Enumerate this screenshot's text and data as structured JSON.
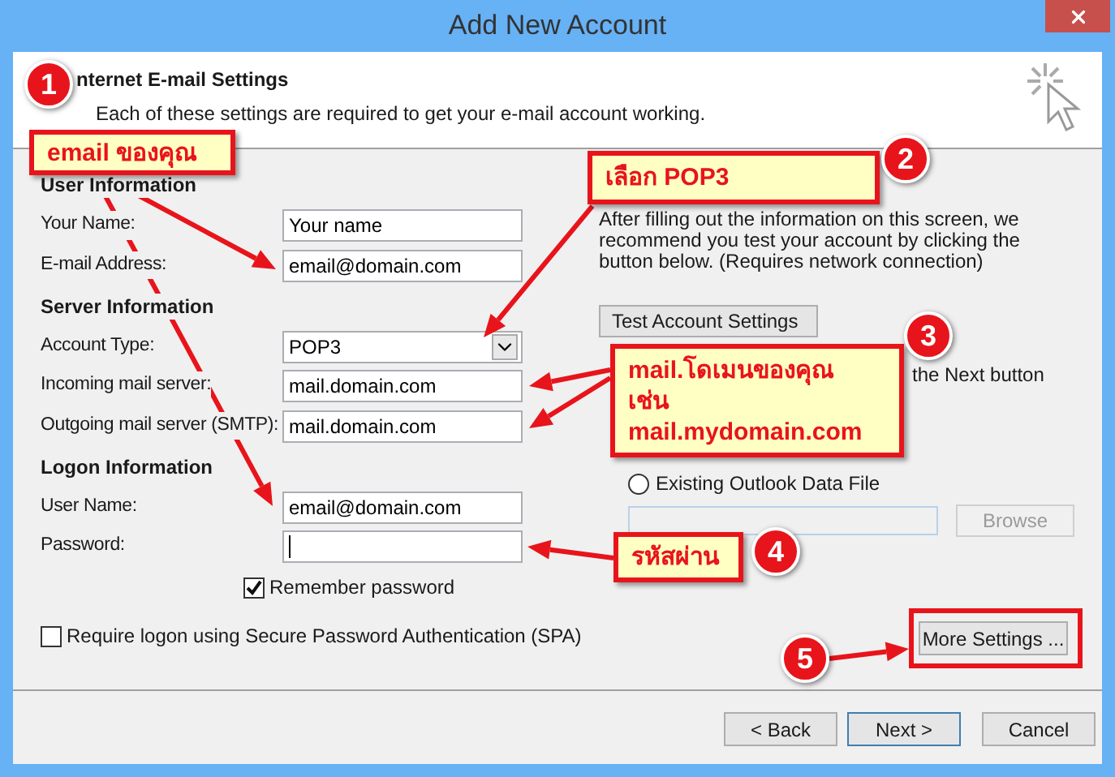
{
  "window": {
    "title": "Add New Account"
  },
  "header": {
    "title": "nternet E-mail Settings",
    "description": "Each of these settings are required to get your e-mail account working."
  },
  "sections": [
    {
      "heading": "User Information",
      "fields": [
        {
          "label": "Your Name:",
          "kind": "text",
          "value": "Your name"
        },
        {
          "label": "E-mail Address:",
          "kind": "text",
          "value": "email@domain.com"
        }
      ]
    },
    {
      "heading": "Server Information",
      "fields": [
        {
          "label": "Account Type:",
          "kind": "select",
          "value": "POP3"
        },
        {
          "label": "Incoming mail server:",
          "kind": "text",
          "value": "mail.domain.com"
        },
        {
          "label": "Outgoing mail server (SMTP):",
          "kind": "text",
          "value": "mail.domain.com"
        }
      ]
    },
    {
      "heading": "Logon Information",
      "fields": [
        {
          "label": "User Name:",
          "kind": "text",
          "value": "email@domain.com"
        },
        {
          "label": "Password:",
          "kind": "password",
          "focused": true
        }
      ]
    }
  ],
  "remember_password": {
    "label": "Remember password",
    "checked": true
  },
  "spa": {
    "label": "Require logon using Secure Password Authentication (SPA)",
    "checked": false
  },
  "test_panel": {
    "description": "After filling out the information on this screen, we recommend you test your account by clicking the button below. (Requires network connection)",
    "test_button": "Test Account Settings",
    "note": "the Next button",
    "data_file": {
      "label": "Existing Outlook Data File",
      "selected": false
    },
    "browse_button": "Browse"
  },
  "more_settings_button": "More Settings ...",
  "footer_buttons": [
    {
      "label": "< Back",
      "default": false
    },
    {
      "label": "Next >",
      "default": true
    },
    {
      "label": "Cancel",
      "default": false
    }
  ],
  "annotations": [
    {
      "number": "1",
      "lines": [
        "email ของคุณ"
      ]
    },
    {
      "number": "2",
      "lines": [
        "เลือก POP3"
      ]
    },
    {
      "number": "3",
      "lines": [
        "mail.โดเมนของคุณ",
        "เช่น",
        "mail.mydomain.com"
      ]
    },
    {
      "number": "4",
      "lines": [
        "รหัสผ่าน"
      ]
    },
    {
      "number": "5"
    }
  ]
}
